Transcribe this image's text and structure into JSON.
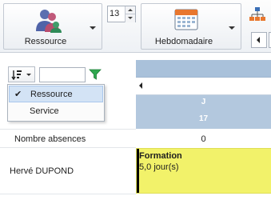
{
  "toolbar": {
    "group_by": {
      "label": "Ressource",
      "icon": "users-icon"
    },
    "count_value": "13",
    "view": {
      "label": "Hebdomadaire",
      "icon": "calendar-icon"
    },
    "org_icon": "org-chart-icon"
  },
  "grid": {
    "day": {
      "letter": "J",
      "number": "17"
    },
    "rows": [
      {
        "label": "Nombre absences",
        "value": "0"
      },
      {
        "label": "Hervé DUPOND"
      }
    ],
    "event": {
      "title": "Formation",
      "duration": "5,0 jour(s)",
      "color": "#f2f26a"
    }
  },
  "sort_menu": {
    "items": [
      {
        "label": "Ressource",
        "checked": true
      },
      {
        "label": "Service",
        "checked": false
      }
    ]
  },
  "colors": {
    "header_blue": "#b3c8de",
    "selection": "#d3e3f5",
    "filter_green": "#2fa84f"
  }
}
